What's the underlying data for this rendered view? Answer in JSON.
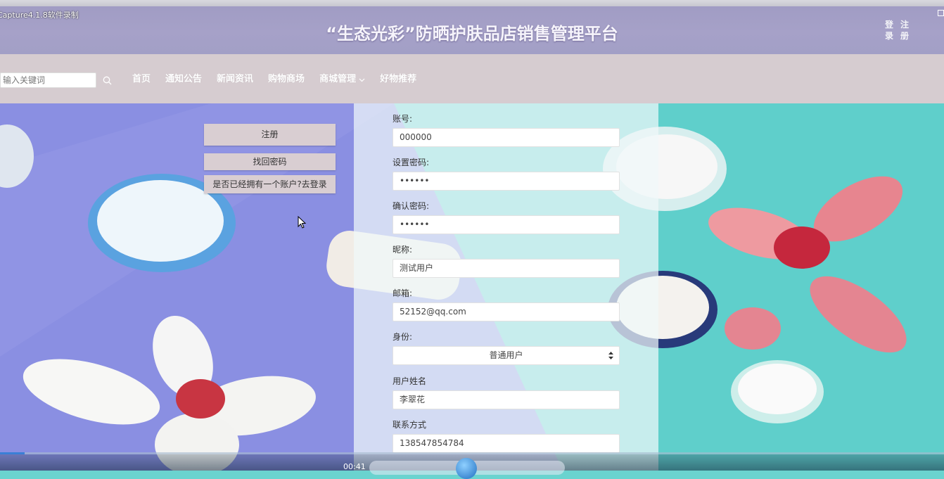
{
  "header": {
    "recorder_label": "Capture4.1.8软件录制",
    "title": "“生态光彩”防晒护肤品店销售管理平台",
    "login_label": "登录",
    "register_label": "注册"
  },
  "search": {
    "placeholder": "输入关键词"
  },
  "nav": {
    "items": [
      {
        "label": "首页"
      },
      {
        "label": "通知公告"
      },
      {
        "label": "新闻资讯"
      },
      {
        "label": "购物商场"
      },
      {
        "label": "商城管理"
      },
      {
        "label": "好物推荐"
      }
    ]
  },
  "side_buttons": {
    "register": "注册",
    "forgot_password": "找回密码",
    "go_login": "是否已经拥有一个账户?去登录"
  },
  "form": {
    "account_label": "账号:",
    "account_value": "000000",
    "password_label": "设置密码:",
    "password_value": "••••••",
    "confirm_label": "确认密码:",
    "confirm_value": "••••••",
    "nickname_label": "昵称:",
    "nickname_value": "测试用户",
    "email_label": "邮箱:",
    "email_value": "52152@qq.com",
    "identity_label": "身份:",
    "identity_value": "普通用户",
    "realname_label": "用户姓名",
    "realname_value": "李翠花",
    "phone_label": "联系方式",
    "phone_value": "138547854784"
  },
  "player": {
    "time": "00:41",
    "progress_fraction": 0.026
  },
  "colors": {
    "header_bg": "#a6a1c8",
    "nav_bg": "#d6ccd0",
    "stage_teal": "#5fcfcb",
    "stage_purple": "#8b8fe0",
    "button_bg": "#d9ced2"
  }
}
